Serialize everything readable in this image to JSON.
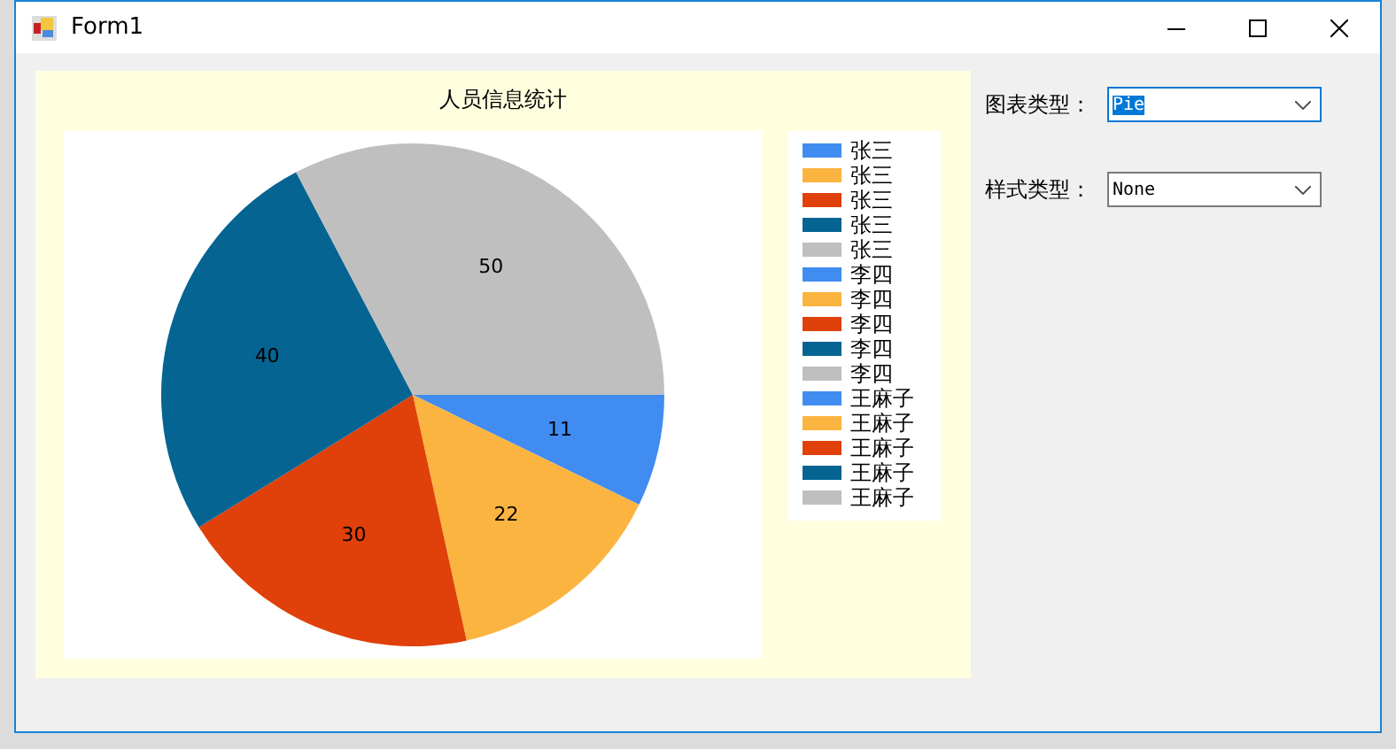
{
  "window": {
    "title": "Form1"
  },
  "chart": {
    "chart_data": {
      "type": "pie",
      "title": "人员信息统计",
      "values": [
        11,
        22,
        30,
        40,
        50
      ],
      "data_labels": true
    },
    "legend": [
      {
        "label": "张三",
        "color": "#418cf0"
      },
      {
        "label": "张三",
        "color": "#fcb441"
      },
      {
        "label": "张三",
        "color": "#e0400a"
      },
      {
        "label": "张三",
        "color": "#056492"
      },
      {
        "label": "张三",
        "color": "#bfbfbf"
      },
      {
        "label": "李四",
        "color": "#418cf0"
      },
      {
        "label": "李四",
        "color": "#fcb441"
      },
      {
        "label": "李四",
        "color": "#e0400a"
      },
      {
        "label": "李四",
        "color": "#056492"
      },
      {
        "label": "李四",
        "color": "#bfbfbf"
      },
      {
        "label": "王麻子",
        "color": "#418cf0"
      },
      {
        "label": "王麻子",
        "color": "#fcb441"
      },
      {
        "label": "王麻子",
        "color": "#e0400a"
      },
      {
        "label": "王麻子",
        "color": "#056492"
      },
      {
        "label": "王麻子",
        "color": "#bfbfbf"
      }
    ]
  },
  "controls": [
    {
      "label": "图表类型：",
      "value": "Pie",
      "focused": true
    },
    {
      "label": "样式类型：",
      "value": "None",
      "focused": false
    }
  ]
}
